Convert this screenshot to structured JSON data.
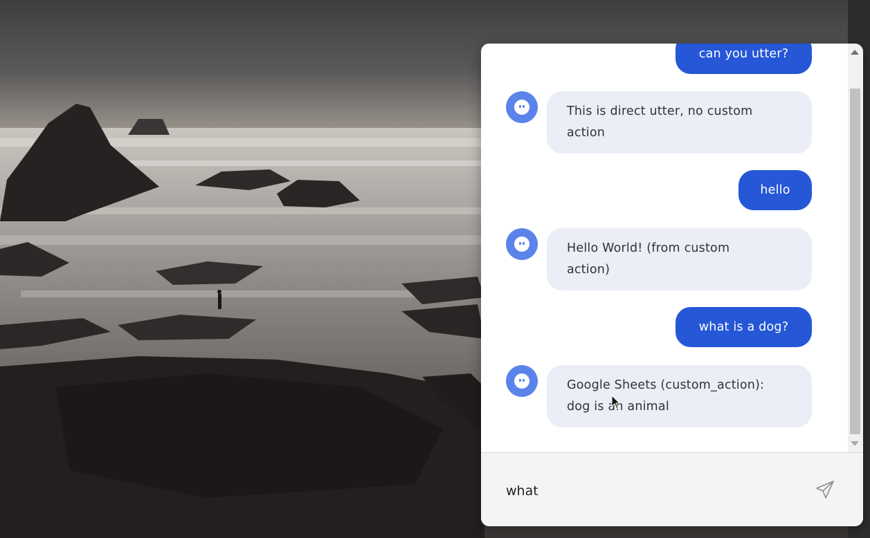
{
  "background": {
    "icon": "rocky-seascape-photo"
  },
  "chat": {
    "messages": [
      {
        "sender": "user",
        "text": "can you utter?"
      },
      {
        "sender": "bot",
        "lines": [
          "This is direct utter, no custom",
          "action"
        ]
      },
      {
        "sender": "user",
        "text": "hello"
      },
      {
        "sender": "bot",
        "lines": [
          "Hello World! (from custom",
          "action)"
        ]
      },
      {
        "sender": "user",
        "text": "what is a dog?"
      },
      {
        "sender": "bot",
        "lines": [
          "Google Sheets (custom_action):",
          "dog is an animal"
        ]
      }
    ],
    "input": {
      "value": "what",
      "placeholder": ""
    },
    "send_icon": "paper-plane-icon",
    "avatar_icon": "bot-face-icon"
  },
  "colors": {
    "user_bubble": "#2557d6",
    "bot_bubble": "#ebedf7",
    "avatar": "#5b84ea"
  }
}
